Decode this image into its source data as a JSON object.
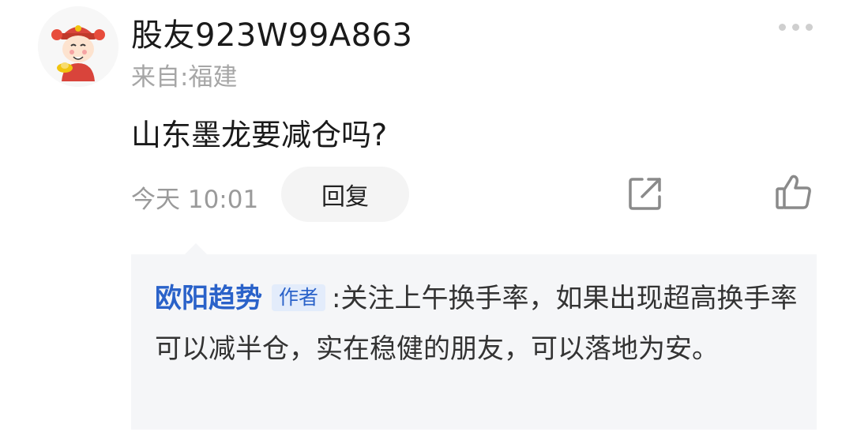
{
  "post": {
    "username": "股友923W99A863",
    "location": "来自:福建",
    "content": "山东墨龙要减仓吗?",
    "time": "今天 10:01",
    "reply_label": "回复"
  },
  "reply": {
    "author": "欧阳趋势",
    "tag": "作者",
    "separator": ":",
    "text": "关注上午换手率，如果出现超高换手率可以减半仓，实在稳健的朋友，可以落地为安。"
  },
  "icons": {
    "avatar": "caishen-avatar",
    "more": "more-icon",
    "share": "share-icon",
    "like": "thumbs-up-icon"
  },
  "colors": {
    "author_blue": "#2a62c9",
    "reply_bg": "#f5f6f8",
    "muted_text": "#a6a6a6"
  }
}
